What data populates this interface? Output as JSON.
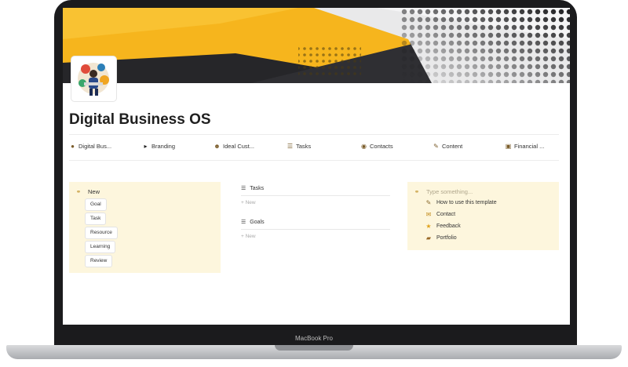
{
  "page": {
    "title": "Digital Business OS"
  },
  "nav": [
    {
      "label": "Digital Bus...",
      "icon": "globe-icon"
    },
    {
      "label": "Branding",
      "icon": "triangle-right-icon"
    },
    {
      "label": "Ideal Cust...",
      "icon": "people-icon"
    },
    {
      "label": "Tasks",
      "icon": "checklist-icon"
    },
    {
      "label": "Contacts",
      "icon": "contacts-icon"
    },
    {
      "label": "Content",
      "icon": "pen-icon"
    },
    {
      "label": "Financial ...",
      "icon": "money-icon"
    }
  ],
  "new_panel": {
    "header": "New",
    "buttons": [
      "Goal",
      "Task",
      "Resource",
      "Learning",
      "Review"
    ]
  },
  "tasks": {
    "label": "Tasks",
    "new_label": "New"
  },
  "goals": {
    "label": "Goals",
    "new_label": "New"
  },
  "links_panel": {
    "placeholder": "Type something...",
    "items": [
      {
        "label": "How to use this template",
        "icon": "pen-note-icon"
      },
      {
        "label": "Contact",
        "icon": "envelope-icon"
      },
      {
        "label": "Feedback",
        "icon": "star-icon"
      },
      {
        "label": "Portfolio",
        "icon": "briefcase-icon"
      }
    ]
  },
  "device": {
    "label": "MacBook Pro"
  },
  "colors": {
    "panel_bg": "#fdf6dd",
    "cover_yellow": "#f6b51d",
    "cover_dark": "#262629"
  }
}
